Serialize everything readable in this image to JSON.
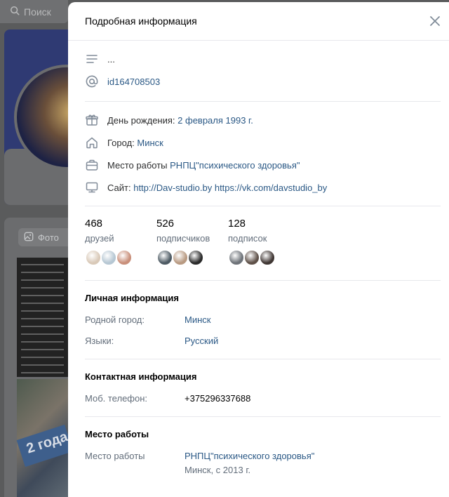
{
  "background": {
    "search_placeholder": "Поиск",
    "photo_button": "Фото",
    "badge_text": "2 года"
  },
  "modal": {
    "title": "Подробная информация",
    "status": "...",
    "user_id": "id164708503",
    "birthday_label": "День рождения:",
    "birthday_value": "2 февраля 1993 г.",
    "city_label": "Город:",
    "city_value": "Минск",
    "work_label": "Место работы",
    "work_value": "РНПЦ\"психического здоровья\"",
    "site_label": "Сайт:",
    "site_value_1": "http://Dav-studio.by",
    "site_value_2": "https://vk.com/davstudio_by"
  },
  "stats": [
    {
      "count": "468",
      "caption": "друзей",
      "avatar_colors": [
        "#d9c9b8",
        "#b6c7d3",
        "#c98f7a"
      ]
    },
    {
      "count": "526",
      "caption": "подписчиков",
      "avatar_colors": [
        "#4d5a63",
        "#b89a82",
        "#2a2a2a"
      ]
    },
    {
      "count": "128",
      "caption": "подписок",
      "avatar_colors": [
        "#6d7278",
        "#5e5048",
        "#3f3633"
      ]
    }
  ],
  "personal": {
    "title": "Личная информация",
    "hometown_label": "Родной город:",
    "hometown_value": "Минск",
    "languages_label": "Языки:",
    "languages_value": "Русский"
  },
  "contacts": {
    "title": "Контактная информация",
    "phone_label": "Моб. телефон:",
    "phone_value": "+375296337688"
  },
  "career": {
    "title": "Место работы",
    "label": "Место работы",
    "value": "РНПЦ\"психического здоровья\"",
    "details": "Минск, с 2013 г."
  },
  "colors": {
    "link": "#2a5885",
    "secondary_text": "#626d7a",
    "icon": "#818c99",
    "divider": "#e7e8ec"
  }
}
